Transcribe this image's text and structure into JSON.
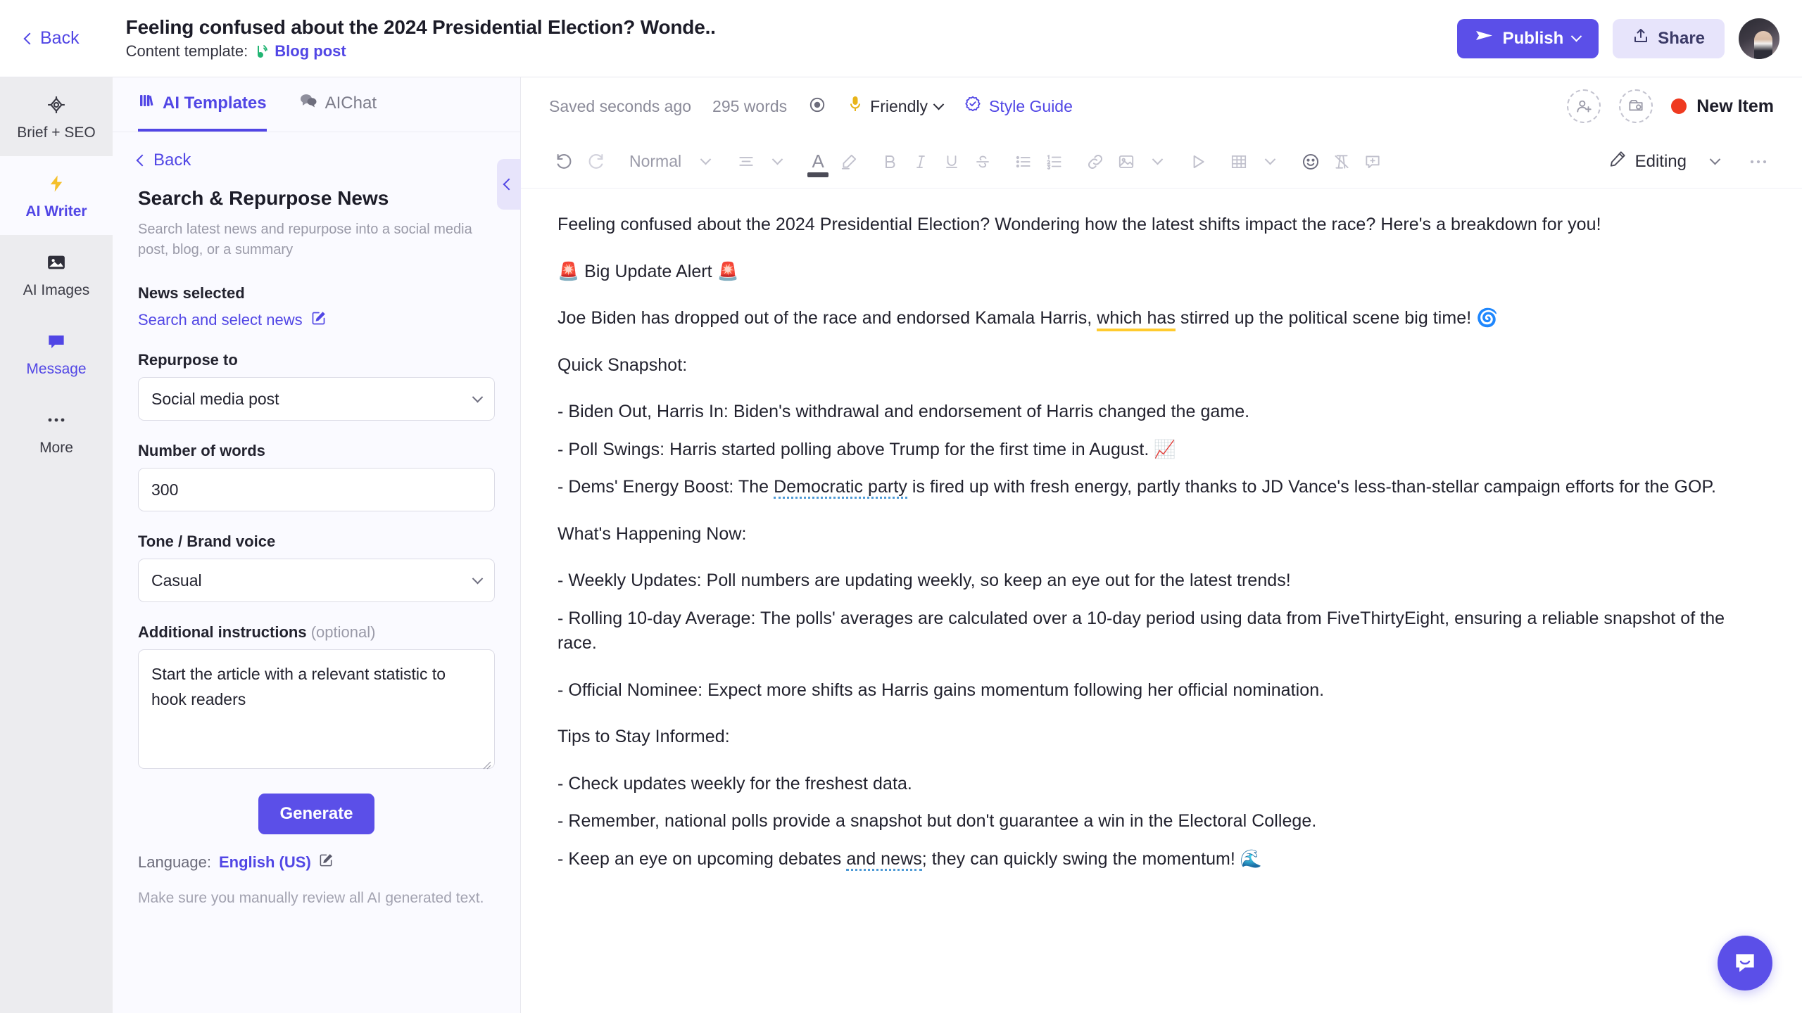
{
  "header": {
    "back_label": "Back",
    "doc_title": "Feeling confused about the 2024 Presidential Election? Wonde..",
    "template_prefix": "Content template:",
    "template_name": "Blog post",
    "publish_label": "Publish",
    "share_label": "Share",
    "accent_color": "#5b4fe8"
  },
  "rail": {
    "items": [
      {
        "label": "Brief + SEO",
        "icon": "target-icon"
      },
      {
        "label": "AI Writer",
        "icon": "lightning-icon"
      },
      {
        "label": "AI Images",
        "icon": "image-icon"
      },
      {
        "label": "Message",
        "icon": "chat-icon"
      },
      {
        "label": "More",
        "icon": "ellipsis-icon"
      }
    ]
  },
  "panel": {
    "tabs": [
      {
        "label": "AI Templates",
        "icon": "templates-icon"
      },
      {
        "label": "AIChat",
        "icon": "chat-bubbles-icon"
      }
    ],
    "back_label": "Back",
    "title": "Search & Repurpose News",
    "description": "Search latest news and repurpose into a social media post, blog, or a summary",
    "news_label": "News selected",
    "news_link": "Search and select news",
    "repurpose_label": "Repurpose to",
    "repurpose_value": "Social media post",
    "words_label": "Number of words",
    "words_value": "300",
    "tone_label": "Tone / Brand voice",
    "tone_value": "Casual",
    "instructions_label": "Additional instructions",
    "instructions_optional": "(optional)",
    "instructions_value": "Start the article with a relevant statistic to hook readers",
    "generate_label": "Generate",
    "language_prefix": "Language:",
    "language_value": "English (US)",
    "disclaimer": "Make sure you manually review all AI generated text."
  },
  "status": {
    "saved": "Saved seconds ago",
    "words": "295 words",
    "tone": "Friendly",
    "style_guide": "Style Guide",
    "new_item": "New Item",
    "new_item_color": "#ef3a20"
  },
  "toolbar": {
    "paragraph_style": "Normal",
    "mode": "Editing",
    "icons": [
      "undo-icon",
      "redo-icon",
      "align-icon",
      "text-color-icon",
      "highlight-icon",
      "bold-icon",
      "italic-icon",
      "underline-icon",
      "strikethrough-icon",
      "bullet-list-icon",
      "numbered-list-icon",
      "link-icon",
      "image-icon",
      "video-icon",
      "table-icon",
      "emoji-icon",
      "clear-format-icon",
      "comment-icon",
      "more-icon"
    ]
  },
  "document": {
    "paragraphs": [
      {
        "id": "intro",
        "text": "Feeling confused about the 2024 Presidential Election? Wondering how the latest shifts impact the race? Here's a breakdown for you!"
      },
      {
        "id": "alert",
        "text": "🚨 Big Update Alert 🚨"
      },
      {
        "id": "biden",
        "text": "Joe Biden has dropped out of the race and endorsed Kamala Harris, which has stirred up the political scene big time! 🌀"
      },
      {
        "id": "snapshot_head",
        "text": "Quick Snapshot:"
      },
      {
        "id": "snapshot_1",
        "text": "- Biden Out, Harris In: Biden's withdrawal and endorsement of Harris changed the game."
      },
      {
        "id": "snapshot_2",
        "text": "- Poll Swings: Harris started polling above Trump for the first time in August. 📈"
      },
      {
        "id": "snapshot_3",
        "text": "- Dems' Energy Boost: The Democratic party is fired up with fresh energy, partly thanks to JD Vance's less-than-stellar campaign efforts for the GOP."
      },
      {
        "id": "happening_head",
        "text": "What's Happening Now:"
      },
      {
        "id": "happening_1",
        "text": "- Weekly Updates: Poll numbers are updating weekly, so keep an eye out for the latest trends!"
      },
      {
        "id": "happening_2",
        "text": "- Rolling 10-day Average: The polls' averages are calculated over a 10-day period using data from FiveThirtyEight, ensuring a reliable snapshot of the race."
      },
      {
        "id": "happening_3",
        "text": "- Official Nominee: Expect more shifts as Harris gains momentum following her official nomination."
      },
      {
        "id": "tips_head",
        "text": "Tips to Stay Informed:"
      },
      {
        "id": "tips_1",
        "text": "- Check updates weekly for the freshest data."
      },
      {
        "id": "tips_2",
        "text": "- Remember, national polls provide a snapshot but don't guarantee a win in the Electoral College."
      },
      {
        "id": "tips_3",
        "text": "- Keep an eye on upcoming debates and news; they can quickly swing the momentum! 🌊"
      }
    ],
    "fragments": {
      "biden_pre": "Joe Biden has dropped out of the race and endorsed Kamala Harris, ",
      "biden_flag": "which has",
      "biden_post": " stirred up the political scene big time! 🌀",
      "dems_pre": "- Dems' Energy Boost: The ",
      "dems_flag": "Democratic party",
      "dems_post": " is fired up with fresh energy, partly thanks to JD Vance's less-than-stellar campaign efforts for the GOP.",
      "tips3_pre": "- Keep an eye on upcoming debates ",
      "tips3_flag": "and news",
      "tips3_post": "; they can quickly swing the momentum! 🌊"
    }
  },
  "chat": {
    "label": "chat-launcher"
  }
}
